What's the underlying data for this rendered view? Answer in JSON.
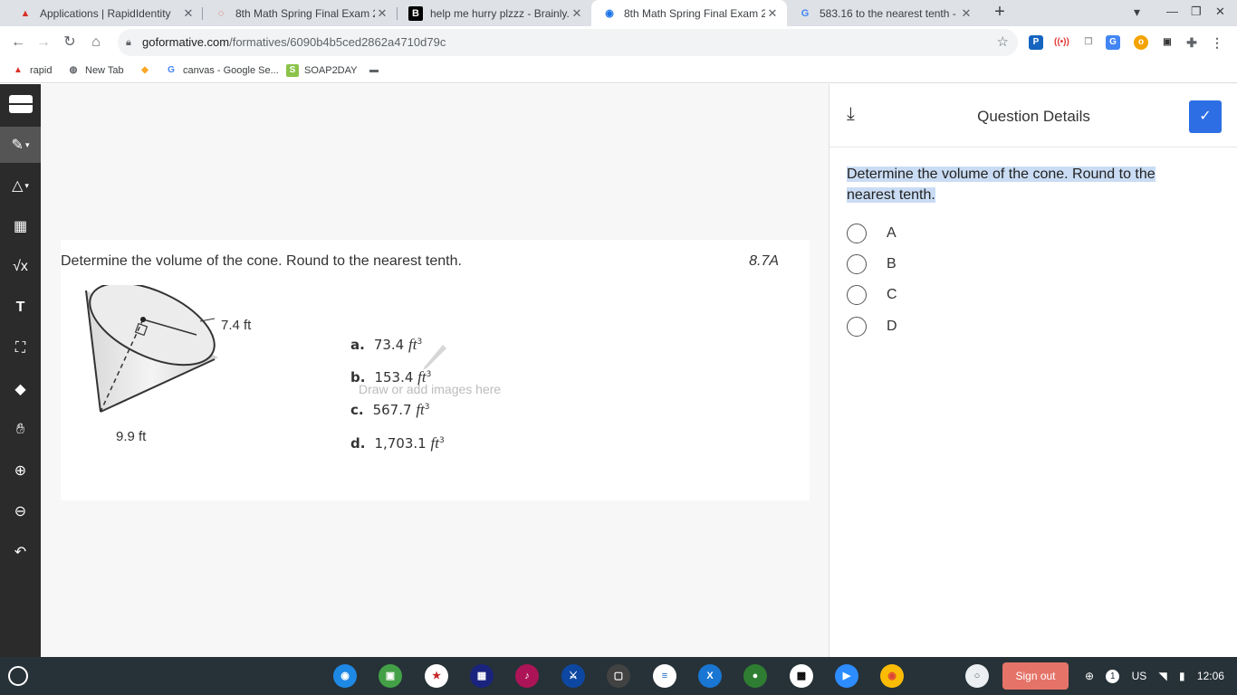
{
  "browser": {
    "tabs": [
      {
        "title": "Applications | RapidIdentity",
        "active": false
      },
      {
        "title": "8th Math Spring Final Exam 202",
        "active": false
      },
      {
        "title": "help me hurry plzzz - Brainly.co",
        "active": false
      },
      {
        "title": "8th Math Spring Final Exam 202",
        "active": true
      },
      {
        "title": "583.16 to the nearest tenth - Go",
        "active": false
      }
    ],
    "url_host": "goformative.com",
    "url_path": "/formatives/6090b4b5ced2862a4710d79c",
    "bookmarks": [
      "rapid",
      "New Tab",
      "canvas - Google Se...",
      "SOAP2DAY"
    ]
  },
  "question": {
    "image_text": "Determine the volume of the cone. Round to the nearest tenth.",
    "standard": "8.7A",
    "radius_label": "7.4 ft",
    "height_label": "9.9 ft",
    "choices": [
      {
        "letter": "a.",
        "value": "73.4",
        "unit": "ft",
        "exp": "3"
      },
      {
        "letter": "b.",
        "value": "153.4",
        "unit": "ft",
        "exp": "3"
      },
      {
        "letter": "c.",
        "value": "567.7",
        "unit": "ft",
        "exp": "3"
      },
      {
        "letter": "d.",
        "value": "1,703.1",
        "unit": "ft",
        "exp": "3"
      }
    ],
    "draw_hint": "Draw or add images here"
  },
  "details": {
    "title": "Question Details",
    "prompt": "Determine the volume of the cone.  Round to the nearest tenth.",
    "options": [
      "A",
      "B",
      "C",
      "D"
    ]
  },
  "shelf": {
    "sign_out": "Sign out",
    "notifications": "1",
    "locale": "US",
    "time": "12:06"
  }
}
